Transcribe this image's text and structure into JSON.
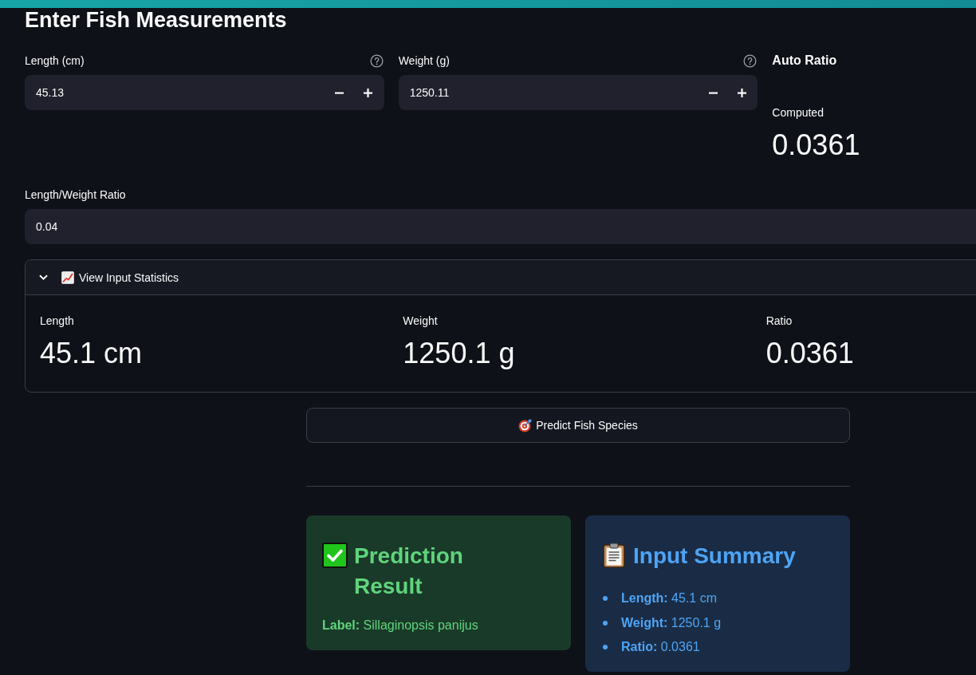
{
  "header": {
    "title": "Enter Fish Measurements"
  },
  "inputs": [
    {
      "label": "Length (cm)",
      "value": "45.13",
      "help": true
    },
    {
      "label": "Weight (g)",
      "value": "1250.11",
      "help": true
    }
  ],
  "auto_ratio": {
    "heading": "Auto Ratio",
    "metric_label": "Computed",
    "metric_value": "0.0361"
  },
  "ratio_input": {
    "label": "Length/Weight Ratio",
    "value": "0.04"
  },
  "statistics": {
    "title": "View Input Statistics",
    "expanded": true,
    "metrics": [
      {
        "label": "Length",
        "value": "45.1 cm"
      },
      {
        "label": "Weight",
        "value": "1250.1 g"
      },
      {
        "label": "Ratio",
        "value": "0.0361"
      }
    ]
  },
  "predict_button": {
    "label": "Predict Fish Species"
  },
  "result": {
    "heading": "Prediction Result",
    "text": "**Label:** Sillaginopsis panijus"
  },
  "summary": {
    "heading": "Input Summary",
    "items": [
      "**Length:** 45.1 cm",
      "**Weight:** 1250.1 g",
      "**Ratio:** 0.0361"
    ]
  }
}
